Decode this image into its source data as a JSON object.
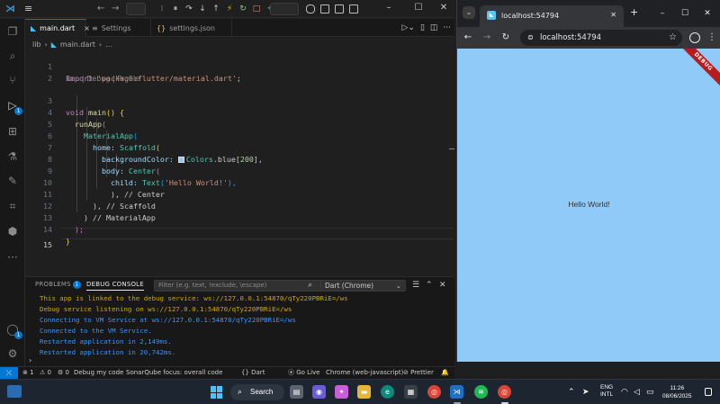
{
  "vscode": {
    "title_search_placeholder": "",
    "tabs": [
      {
        "label": "main.dart",
        "icon": "dart-icon",
        "active": true,
        "close": "×"
      },
      {
        "label": "Settings",
        "icon": "settings-icon",
        "active": false
      },
      {
        "label": "settings.json",
        "icon": "json-icon",
        "active": false,
        "prefix": "{}"
      }
    ],
    "breadcrumb": {
      "folder": "lib",
      "sep": "›",
      "file": "main.dart",
      "more": "…"
    },
    "code": {
      "line_numbers": [
        "1",
        "2",
        "3",
        "4",
        "5",
        "6",
        "7",
        "8",
        "9",
        "10",
        "11",
        "12",
        "13",
        "14",
        "15"
      ],
      "codelens": "Run | Debug | Profile",
      "line1": {
        "kw": "import",
        "str": "'package:flutter/material.dart'",
        "end": ";"
      },
      "line3": {
        "kw": "void",
        "fn": "main",
        "rest": "() {"
      },
      "line4": {
        "fn": "runApp",
        "br": "("
      },
      "line5": {
        "cls": "MaterialApp",
        "br": "("
      },
      "line6": {
        "prop": "home:",
        "cls": "Scaffold",
        "br": "("
      },
      "line7": {
        "prop": "backgroundColor:",
        "cls": "Colors",
        "rest": ".blue[",
        "num": "200",
        "end": "],"
      },
      "line8": {
        "prop": "body:",
        "cls": "Center",
        "br": "("
      },
      "line9": {
        "prop": "child:",
        "cls": "Text",
        "br": "(",
        "str": "'Hello World!'",
        "end": "),"
      },
      "line10": {
        "text": "), // Center"
      },
      "line11": {
        "text": "), // Scaffold"
      },
      "line12": {
        "text": ") // MaterialApp"
      },
      "line13": {
        "text": ");"
      },
      "line14": {
        "text": "}"
      }
    },
    "panel": {
      "tab_problems": "PROBLEMS",
      "problems_count": "1",
      "tab_debug_console": "DEBUG CONSOLE",
      "filter_placeholder": "Filter (e.g. text, !exclude, \\escape)",
      "session": "Dart (Chrome)",
      "console_lines": [
        "This app is linked to the debug service: ws://127.0.0.1:54870/qTy220PBRiE=/ws",
        "Debug service listening on ws://127.0.0.1:54870/qTy220PBRiE=/ws",
        "Connecting to VM Service at ws://127.0.0.1:54870/qTy220PBRiE=/ws",
        "Connected to the VM Service.",
        "Restarted application in 2,149ms.",
        "Restarted application in 20,742ms."
      ],
      "prompt": "›"
    },
    "status": {
      "remote": "⤫",
      "errors": "⊗ 1",
      "warnings": "⚠ 0",
      "debug_count": "0",
      "debug_my_code": "Debug my code",
      "sonar": "SonarQube focus: overall code",
      "lang": "{} Dart",
      "golive": "Go Live",
      "device": "Chrome (web-javascript)",
      "prettier": "Prettier",
      "bell": "🔔"
    },
    "activity_badges": {
      "debug": "1",
      "accounts": "1"
    }
  },
  "chrome": {
    "tab_title": "localhost:54794",
    "url": "localhost:54794",
    "page_text": "Hello World!",
    "debug_banner": "DEBUG",
    "colors": {
      "page_bg": "#90caf9"
    }
  },
  "taskbar": {
    "search_label": "Search",
    "lang_top": "ENG",
    "lang_bottom": "INTL",
    "time": "11:26",
    "date": "08/06/2025"
  }
}
